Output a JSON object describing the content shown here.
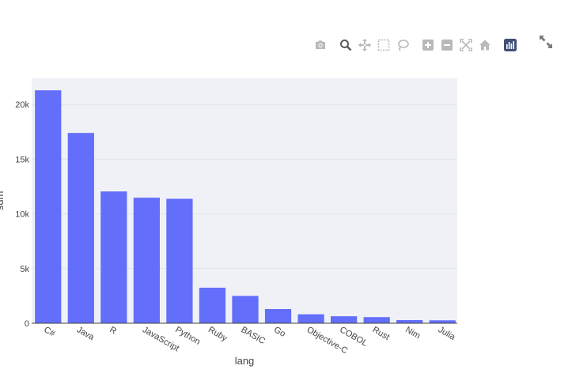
{
  "modebar": {
    "buttons": [
      {
        "name": "camera-icon",
        "title": "Download plot as a png"
      },
      {
        "name": "zoom-icon",
        "title": "Zoom"
      },
      {
        "name": "pan-icon",
        "title": "Pan"
      },
      {
        "name": "box-select-icon",
        "title": "Box Select"
      },
      {
        "name": "lasso-select-icon",
        "title": "Lasso Select"
      },
      {
        "name": "zoom-in-icon",
        "title": "Zoom in"
      },
      {
        "name": "zoom-out-icon",
        "title": "Zoom out"
      },
      {
        "name": "autoscale-icon",
        "title": "Autoscale"
      },
      {
        "name": "reset-axes-icon",
        "title": "Reset axes"
      },
      {
        "name": "plotly-logo-icon",
        "title": "Produced with Plotly"
      }
    ],
    "icon_color": "#b9b9b9",
    "active_color": "#5c5c5c"
  },
  "expand": {
    "name": "expand-icon"
  },
  "chart_data": {
    "type": "bar",
    "categories": [
      "C#",
      "Java",
      "R",
      "JavaScript",
      "Python",
      "Ruby",
      "BASIC",
      "Go",
      "Objective-C",
      "COBOL",
      "Rust",
      "Nim",
      "Julia"
    ],
    "values": [
      21300,
      17400,
      12050,
      11480,
      11380,
      3250,
      2500,
      1300,
      820,
      640,
      560,
      290,
      270
    ],
    "xlabel": "lang",
    "ylabel": "sum",
    "ylim": [
      0,
      22400
    ],
    "yticks": [
      0,
      5000,
      10000,
      15000,
      20000
    ],
    "ytick_labels": [
      "0",
      "5k",
      "10k",
      "15k",
      "20k"
    ],
    "bar_color": "#636efa",
    "plot_bgcolor": "#e5ecf6",
    "grid": true
  }
}
